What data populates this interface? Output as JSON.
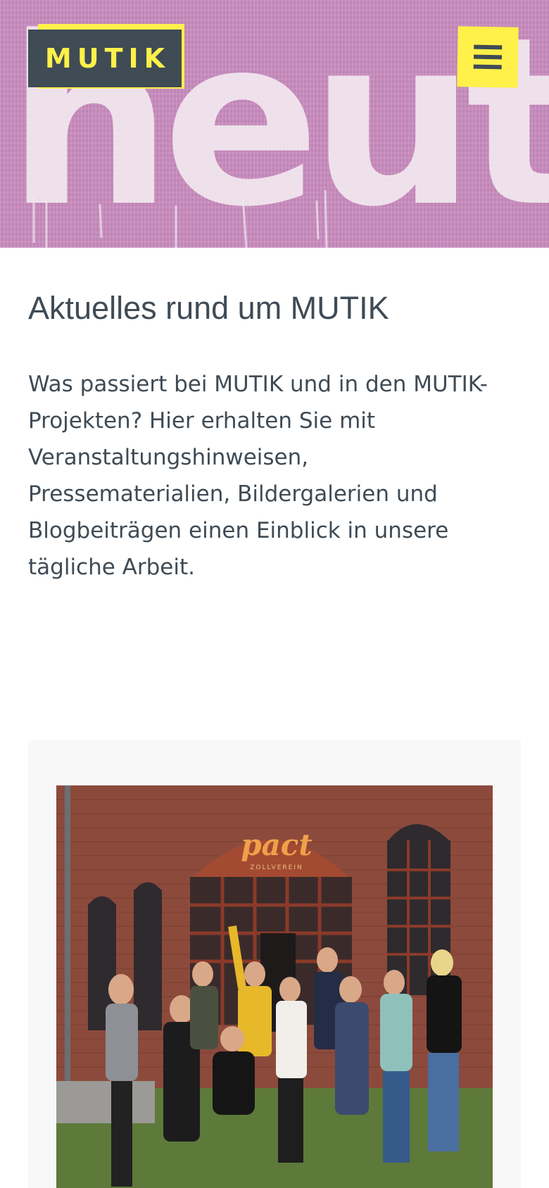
{
  "header": {
    "logo_text": "MUTIK",
    "hero_word": "heute",
    "menu_icon": "hamburger-menu-icon"
  },
  "colors": {
    "accent_yellow": "#fff04a",
    "dark_slate": "#3f4b55",
    "hero_pink": "#c98cbf"
  },
  "main": {
    "title": "Aktuelles rund um MUTIK",
    "intro_lines": [
      "Was passiert bei MUTIK und in den MUTIK-",
      "Projekten? Hier erhalten Sie mit",
      "Veranstaltungshinweisen,",
      "Pressematerialien, Bildergalerien und",
      "Blogbeiträgen einen Einblick in unsere",
      "tägliche Arbeit."
    ]
  },
  "card": {
    "sign_text": "pact",
    "sign_subtext": "ZOLLVEREIN"
  }
}
